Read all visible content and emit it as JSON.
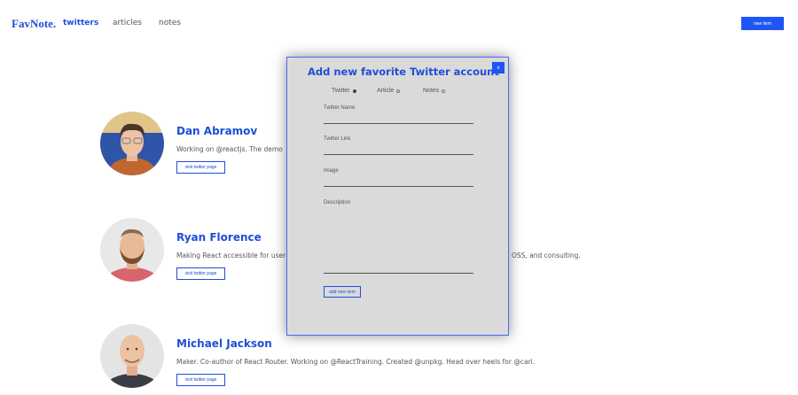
{
  "header": {
    "logo": "FavNote.",
    "nav": [
      {
        "label": "twitters",
        "active": true
      },
      {
        "label": "articles",
        "active": false
      },
      {
        "label": "notes",
        "active": false
      }
    ],
    "new_item_label": "new item"
  },
  "cards": [
    {
      "name": "Dan Abramov",
      "description": "Working on @reactjs. The demo",
      "button_label": "visit twitter page"
    },
    {
      "name": "Ryan Florence",
      "description": "Making React accessible for user",
      "description_tail": "OSS, and consulting.",
      "button_label": "visit twitter page"
    },
    {
      "name": "Michael Jackson",
      "description": "Maker. Co-author of React Router. Working on @ReactTraining. Created @unpkg. Head over heels for @cari.",
      "button_label": "visit twitter page"
    }
  ],
  "modal": {
    "title": "Add new favorite Twitter account",
    "close_label": "x",
    "types": [
      {
        "label": "Twitter",
        "checked": true
      },
      {
        "label": "Article",
        "checked": false
      },
      {
        "label": "Notes",
        "checked": false
      }
    ],
    "fields": {
      "twitter_name": "Twitter Name",
      "twitter_link": "Twitter Link",
      "image": "Image",
      "description": "Description"
    },
    "submit_label": "add new item"
  },
  "colors": {
    "accent": "#1f4ed8",
    "button": "#1f55f5",
    "modal_bg": "#dadada"
  }
}
